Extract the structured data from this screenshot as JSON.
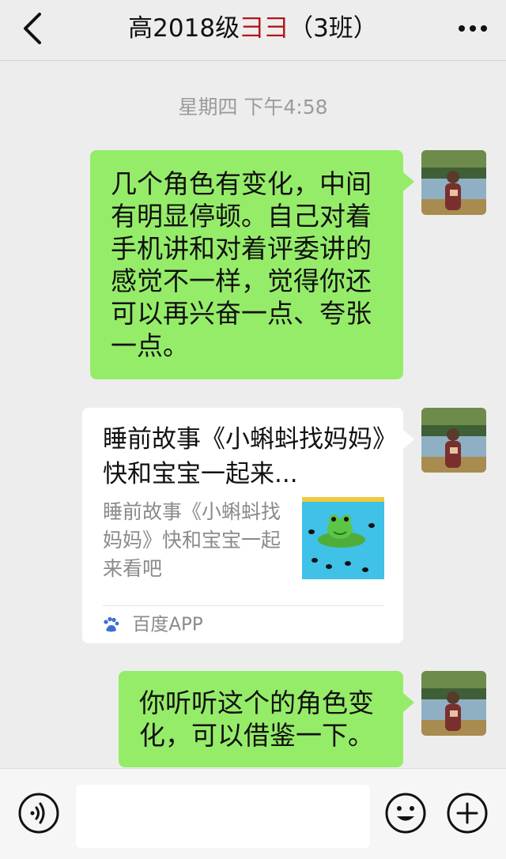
{
  "header": {
    "title_prefix": "高2018级",
    "title_redacted": "彐彐",
    "title_suffix": "（3班）"
  },
  "chat": {
    "timestamp": "星期四 下午4:58",
    "messages": [
      {
        "type": "text",
        "text": "几个角色有变化，中间有明显停顿。自己对着手机讲和对着评委讲的感觉不一样，觉得你还可以再兴奋一点、夸张一点。"
      },
      {
        "type": "link-card",
        "title": "睡前故事《小蝌蚪找妈妈》快和宝宝一起来...",
        "description": "睡前故事《小蝌蚪找妈妈》快和宝宝一起来看吧",
        "source": "百度APP"
      },
      {
        "type": "text",
        "text": "你听听这个的角色变化，可以借鉴一下。"
      }
    ]
  },
  "input_bar": {
    "placeholder": ""
  },
  "icons": {
    "back": "chevron-left-icon",
    "more": "more-dots-icon",
    "voice": "voice-icon",
    "emoji": "emoji-icon",
    "plus": "plus-icon",
    "source": "baidu-paw-icon"
  },
  "colors": {
    "background": "#ededed",
    "bubble_sent": "#95ec69",
    "card": "#ffffff"
  }
}
